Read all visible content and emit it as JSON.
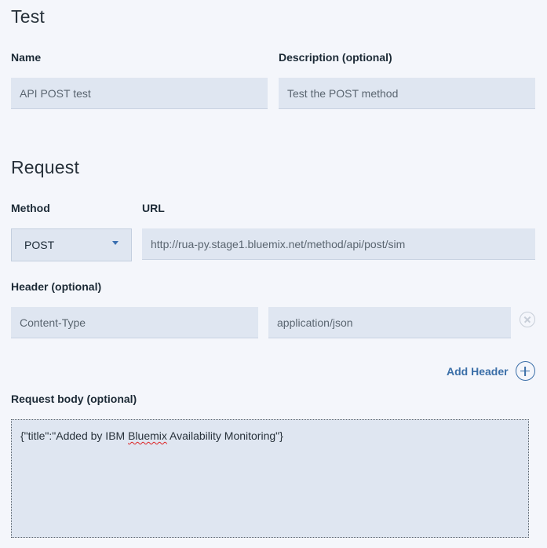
{
  "test": {
    "title": "Test",
    "name_label": "Name",
    "name_value": "API POST test",
    "description_label": "Description (optional)",
    "description_value": "Test the POST method"
  },
  "request": {
    "title": "Request",
    "method_label": "Method",
    "method_value": "POST",
    "url_label": "URL",
    "url_value": "http://rua-py.stage1.bluemix.net/method/api/post/sim",
    "header_label": "Header (optional)",
    "header_key": "Content-Type",
    "header_value": "application/json",
    "add_header_label": "Add Header",
    "body_label": "Request body (optional)",
    "body_prefix": "{\"title\":\"Added by IBM ",
    "body_misspelled": "Bluemix",
    "body_suffix": " Availability Monitoring\"}"
  },
  "icons": {
    "remove_header": "close-circle-icon",
    "add_header": "plus-circle-icon",
    "method_dropdown": "caret-down-icon"
  },
  "colors": {
    "background": "#f4f6fb",
    "field": "#dfe6f1",
    "accent": "#3b6fa8",
    "spellcheck": "#dd2222"
  }
}
